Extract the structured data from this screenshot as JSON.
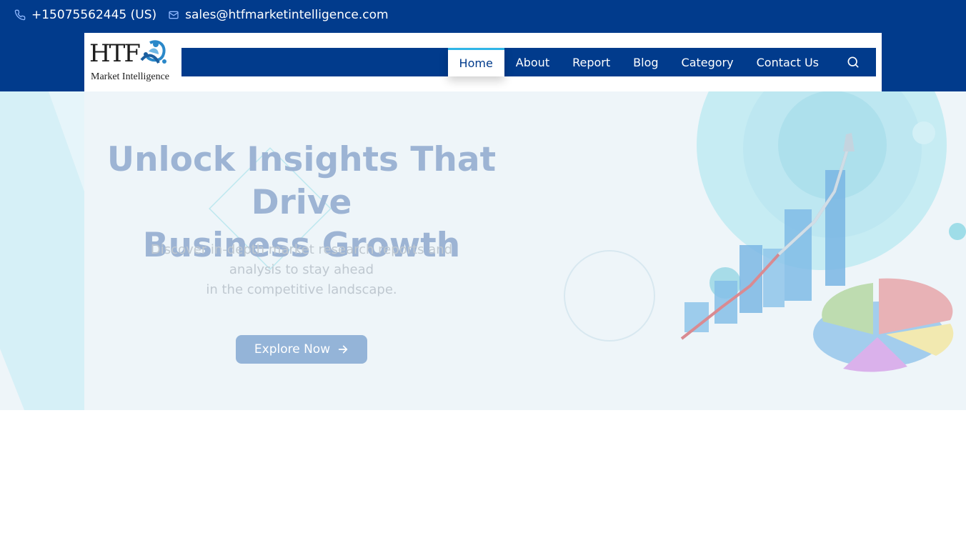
{
  "contact": {
    "phone": "+15075562445 (US)",
    "email": "sales@htfmarketintelligence.com",
    "phone_icon": "phone-icon",
    "email_icon": "mail-icon"
  },
  "logo": {
    "main": "HTF",
    "sub": "Market Intelligence"
  },
  "nav": {
    "items": [
      {
        "label": "Home",
        "active": true
      },
      {
        "label": "About"
      },
      {
        "label": "Report"
      },
      {
        "label": "Blog"
      },
      {
        "label": "Category"
      },
      {
        "label": "Contact Us"
      }
    ],
    "search_icon": "search-icon"
  },
  "hero": {
    "title_line1": "Unlock Insights That Drive",
    "title_line2": "Business Growth",
    "desc_line1": "Discover in-depth market research reports and",
    "desc_line2": "analysis to stay ahead",
    "desc_line3": "in the competitive landscape.",
    "button_label": "Explore Now",
    "button_icon": "arrow-right-icon"
  },
  "colors": {
    "brand_blue": "#013b8c",
    "accent_cyan": "#2fb5e6",
    "hero_bg": "#eef5f9",
    "button": "#94b4d8"
  }
}
